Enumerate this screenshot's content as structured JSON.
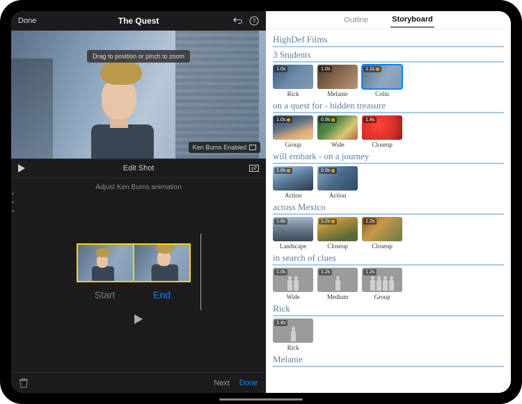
{
  "topbar": {
    "done": "Done",
    "title": "The Quest"
  },
  "preview": {
    "tooltip": "Drag to position or pinch to zoom",
    "kenburns_badge": "Ken Burns Enabled"
  },
  "editbar": {
    "title": "Edit Shot"
  },
  "subtitle": "Adjust Ken Burns animation",
  "frames": {
    "start": "Start",
    "end": "End"
  },
  "bottombar": {
    "next": "Next",
    "done": "Done"
  },
  "tabs": {
    "outline": "Outline",
    "storyboard": "Storyboard"
  },
  "sections": [
    {
      "title": "HighDef Films",
      "clips": []
    },
    {
      "title": "3 Students",
      "clips": [
        {
          "dur": "1.0s",
          "label": "Rick",
          "theme": "t1",
          "dot": false,
          "sel": false
        },
        {
          "dur": "1.0s",
          "label": "Melanie",
          "theme": "t2",
          "dot": false,
          "sel": false
        },
        {
          "dur": "1.1s",
          "label": "Colin",
          "theme": "t3",
          "dot": true,
          "sel": true
        }
      ]
    },
    {
      "title": "on a quest for - hidden treasure",
      "clips": [
        {
          "dur": "1.0s",
          "label": "Group",
          "theme": "t4",
          "dot": true,
          "sel": false
        },
        {
          "dur": "0.9s",
          "label": "Wide",
          "theme": "t5",
          "dot": true,
          "sel": false
        },
        {
          "dur": "1.4s",
          "label": "Closeup",
          "theme": "t6",
          "dot": false,
          "sel": false
        }
      ]
    },
    {
      "title": "will embark - on a journey",
      "clips": [
        {
          "dur": "1.0s",
          "label": "Action",
          "theme": "t7",
          "dot": true,
          "sel": false
        },
        {
          "dur": "0.9s",
          "label": "Action",
          "theme": "t8",
          "dot": true,
          "sel": false
        }
      ]
    },
    {
      "title": "across Mexico",
      "clips": [
        {
          "dur": "1.8s",
          "label": "Landscape",
          "theme": "t9",
          "dot": false,
          "sel": false
        },
        {
          "dur": "1.2s",
          "label": "Closeup",
          "theme": "t10",
          "dot": true,
          "sel": false
        },
        {
          "dur": "1.2s",
          "label": "Closeup",
          "theme": "t11",
          "dot": false,
          "sel": false
        }
      ]
    },
    {
      "title": "in search of clues",
      "clips": [
        {
          "dur": "1.0s",
          "label": "Wide",
          "theme": "placeholder",
          "people": 2,
          "sel": false
        },
        {
          "dur": "1.2s",
          "label": "Medium",
          "theme": "placeholder",
          "people": 1,
          "sel": false
        },
        {
          "dur": "1.2s",
          "label": "Group",
          "theme": "placeholder",
          "people": 4,
          "sel": false
        }
      ]
    },
    {
      "title": "Rick",
      "clips": [
        {
          "dur": "1.4s",
          "label": "Rick",
          "theme": "placeholder",
          "people": 1,
          "sel": false
        }
      ]
    },
    {
      "title": "Melanie",
      "clips": []
    }
  ]
}
